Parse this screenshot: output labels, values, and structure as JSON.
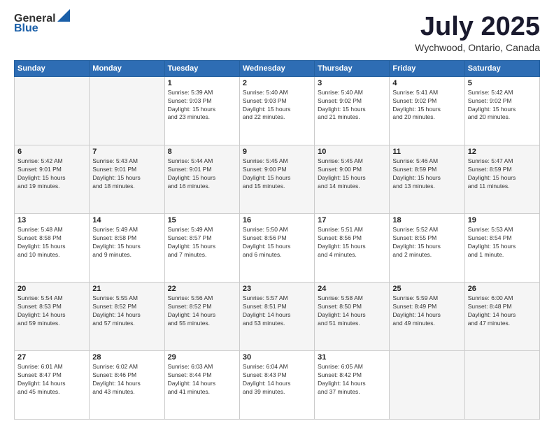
{
  "header": {
    "logo_general": "General",
    "logo_blue": "Blue",
    "month_title": "July 2025",
    "location": "Wychwood, Ontario, Canada"
  },
  "days_of_week": [
    "Sunday",
    "Monday",
    "Tuesday",
    "Wednesday",
    "Thursday",
    "Friday",
    "Saturday"
  ],
  "weeks": [
    [
      {
        "day": "",
        "info": ""
      },
      {
        "day": "",
        "info": ""
      },
      {
        "day": "1",
        "info": "Sunrise: 5:39 AM\nSunset: 9:03 PM\nDaylight: 15 hours\nand 23 minutes."
      },
      {
        "day": "2",
        "info": "Sunrise: 5:40 AM\nSunset: 9:03 PM\nDaylight: 15 hours\nand 22 minutes."
      },
      {
        "day": "3",
        "info": "Sunrise: 5:40 AM\nSunset: 9:02 PM\nDaylight: 15 hours\nand 21 minutes."
      },
      {
        "day": "4",
        "info": "Sunrise: 5:41 AM\nSunset: 9:02 PM\nDaylight: 15 hours\nand 20 minutes."
      },
      {
        "day": "5",
        "info": "Sunrise: 5:42 AM\nSunset: 9:02 PM\nDaylight: 15 hours\nand 20 minutes."
      }
    ],
    [
      {
        "day": "6",
        "info": "Sunrise: 5:42 AM\nSunset: 9:01 PM\nDaylight: 15 hours\nand 19 minutes."
      },
      {
        "day": "7",
        "info": "Sunrise: 5:43 AM\nSunset: 9:01 PM\nDaylight: 15 hours\nand 18 minutes."
      },
      {
        "day": "8",
        "info": "Sunrise: 5:44 AM\nSunset: 9:01 PM\nDaylight: 15 hours\nand 16 minutes."
      },
      {
        "day": "9",
        "info": "Sunrise: 5:45 AM\nSunset: 9:00 PM\nDaylight: 15 hours\nand 15 minutes."
      },
      {
        "day": "10",
        "info": "Sunrise: 5:45 AM\nSunset: 9:00 PM\nDaylight: 15 hours\nand 14 minutes."
      },
      {
        "day": "11",
        "info": "Sunrise: 5:46 AM\nSunset: 8:59 PM\nDaylight: 15 hours\nand 13 minutes."
      },
      {
        "day": "12",
        "info": "Sunrise: 5:47 AM\nSunset: 8:59 PM\nDaylight: 15 hours\nand 11 minutes."
      }
    ],
    [
      {
        "day": "13",
        "info": "Sunrise: 5:48 AM\nSunset: 8:58 PM\nDaylight: 15 hours\nand 10 minutes."
      },
      {
        "day": "14",
        "info": "Sunrise: 5:49 AM\nSunset: 8:58 PM\nDaylight: 15 hours\nand 9 minutes."
      },
      {
        "day": "15",
        "info": "Sunrise: 5:49 AM\nSunset: 8:57 PM\nDaylight: 15 hours\nand 7 minutes."
      },
      {
        "day": "16",
        "info": "Sunrise: 5:50 AM\nSunset: 8:56 PM\nDaylight: 15 hours\nand 6 minutes."
      },
      {
        "day": "17",
        "info": "Sunrise: 5:51 AM\nSunset: 8:56 PM\nDaylight: 15 hours\nand 4 minutes."
      },
      {
        "day": "18",
        "info": "Sunrise: 5:52 AM\nSunset: 8:55 PM\nDaylight: 15 hours\nand 2 minutes."
      },
      {
        "day": "19",
        "info": "Sunrise: 5:53 AM\nSunset: 8:54 PM\nDaylight: 15 hours\nand 1 minute."
      }
    ],
    [
      {
        "day": "20",
        "info": "Sunrise: 5:54 AM\nSunset: 8:53 PM\nDaylight: 14 hours\nand 59 minutes."
      },
      {
        "day": "21",
        "info": "Sunrise: 5:55 AM\nSunset: 8:52 PM\nDaylight: 14 hours\nand 57 minutes."
      },
      {
        "day": "22",
        "info": "Sunrise: 5:56 AM\nSunset: 8:52 PM\nDaylight: 14 hours\nand 55 minutes."
      },
      {
        "day": "23",
        "info": "Sunrise: 5:57 AM\nSunset: 8:51 PM\nDaylight: 14 hours\nand 53 minutes."
      },
      {
        "day": "24",
        "info": "Sunrise: 5:58 AM\nSunset: 8:50 PM\nDaylight: 14 hours\nand 51 minutes."
      },
      {
        "day": "25",
        "info": "Sunrise: 5:59 AM\nSunset: 8:49 PM\nDaylight: 14 hours\nand 49 minutes."
      },
      {
        "day": "26",
        "info": "Sunrise: 6:00 AM\nSunset: 8:48 PM\nDaylight: 14 hours\nand 47 minutes."
      }
    ],
    [
      {
        "day": "27",
        "info": "Sunrise: 6:01 AM\nSunset: 8:47 PM\nDaylight: 14 hours\nand 45 minutes."
      },
      {
        "day": "28",
        "info": "Sunrise: 6:02 AM\nSunset: 8:46 PM\nDaylight: 14 hours\nand 43 minutes."
      },
      {
        "day": "29",
        "info": "Sunrise: 6:03 AM\nSunset: 8:44 PM\nDaylight: 14 hours\nand 41 minutes."
      },
      {
        "day": "30",
        "info": "Sunrise: 6:04 AM\nSunset: 8:43 PM\nDaylight: 14 hours\nand 39 minutes."
      },
      {
        "day": "31",
        "info": "Sunrise: 6:05 AM\nSunset: 8:42 PM\nDaylight: 14 hours\nand 37 minutes."
      },
      {
        "day": "",
        "info": ""
      },
      {
        "day": "",
        "info": ""
      }
    ]
  ]
}
